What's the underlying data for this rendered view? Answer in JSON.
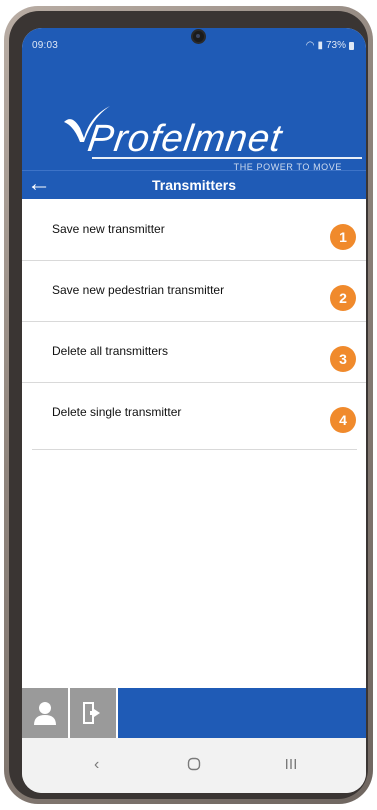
{
  "status_bar": {
    "time": "09:03",
    "battery": "73%"
  },
  "brand": {
    "name": "Profelmnet",
    "tagline": "THE POWER TO MOVE",
    "primary_color": "#1f5bb6",
    "accent_color": "#f08a2c"
  },
  "titlebar": {
    "title": "Transmitters",
    "back_icon": "arrow-left-icon"
  },
  "menu": {
    "items": [
      {
        "label": "Save new transmitter",
        "badge": "1"
      },
      {
        "label": "Save new pedestrian transmitter",
        "badge": "2"
      },
      {
        "label": "Delete all transmitters",
        "badge": "3"
      },
      {
        "label": "Delete single transmitter",
        "badge": "4"
      }
    ]
  },
  "bottom_bar": {
    "buttons": [
      {
        "icon": "user-icon"
      },
      {
        "icon": "exit-door-icon"
      }
    ]
  },
  "system_nav": {
    "buttons": [
      {
        "icon": "back-chevron-icon"
      },
      {
        "icon": "home-circle-icon"
      },
      {
        "icon": "recents-icon"
      }
    ]
  }
}
